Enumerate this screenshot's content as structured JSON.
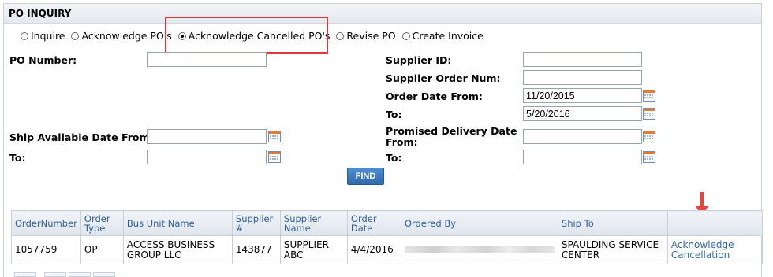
{
  "panel": {
    "title": "PO INQUIRY"
  },
  "radios": [
    {
      "label": "Inquire",
      "checked": false
    },
    {
      "label": "Acknowledge PO's",
      "checked": false
    },
    {
      "label": "Acknowledge Cancelled PO's",
      "checked": true
    },
    {
      "label": "Revise PO",
      "checked": false
    },
    {
      "label": "Create Invoice",
      "checked": false
    }
  ],
  "form": {
    "po_number_label": "PO Number:",
    "po_number_value": "",
    "supplier_id_label": "Supplier ID:",
    "supplier_id_value": "",
    "supplier_order_num_label": "Supplier Order Num:",
    "supplier_order_num_value": "",
    "order_date_from_label": "Order Date From:",
    "order_date_from_value": "11/20/2015",
    "order_date_to_label": "To:",
    "order_date_to_value": "5/20/2016",
    "ship_available_from_label": "Ship Available Date From:",
    "ship_available_from_value": "",
    "ship_available_to_label": "To:",
    "ship_available_to_value": "",
    "promised_delivery_from_label_1": "Promised Delivery Date",
    "promised_delivery_from_label_2": "From:",
    "promised_delivery_from_value": "",
    "promised_delivery_to_label": "To:",
    "promised_delivery_to_value": "",
    "find_label": "FIND"
  },
  "table": {
    "headers": {
      "order_number": "OrderNumber",
      "order_type_1": "Order",
      "order_type_2": "Type",
      "bus_unit_name": "Bus Unit Name",
      "supplier_num_1": "Supplier",
      "supplier_num_2": "#",
      "supplier_name_1": "Supplier",
      "supplier_name_2": "Name",
      "order_date": "Order Date",
      "ordered_by": "Ordered By",
      "ship_to": "Ship To"
    },
    "rows": [
      {
        "order_number": "1057759",
        "order_type": "OP",
        "bus_unit_name_1": "ACCESS BUSINESS",
        "bus_unit_name_2": "GROUP LLC",
        "supplier_num": "143877",
        "supplier_name_1": "SUPPLIER",
        "supplier_name_2": "ABC",
        "order_date": "4/4/2016",
        "ship_to_1": "SPAULDING SERVICE",
        "ship_to_2": "CENTER",
        "action_1": "Acknowledge",
        "action_2": "Cancellation"
      }
    ]
  },
  "colors": {
    "highlight_box": "#e2353a",
    "arrow": "#e8463c",
    "link": "#2f6ab0",
    "find_button": "#3a78bf"
  }
}
